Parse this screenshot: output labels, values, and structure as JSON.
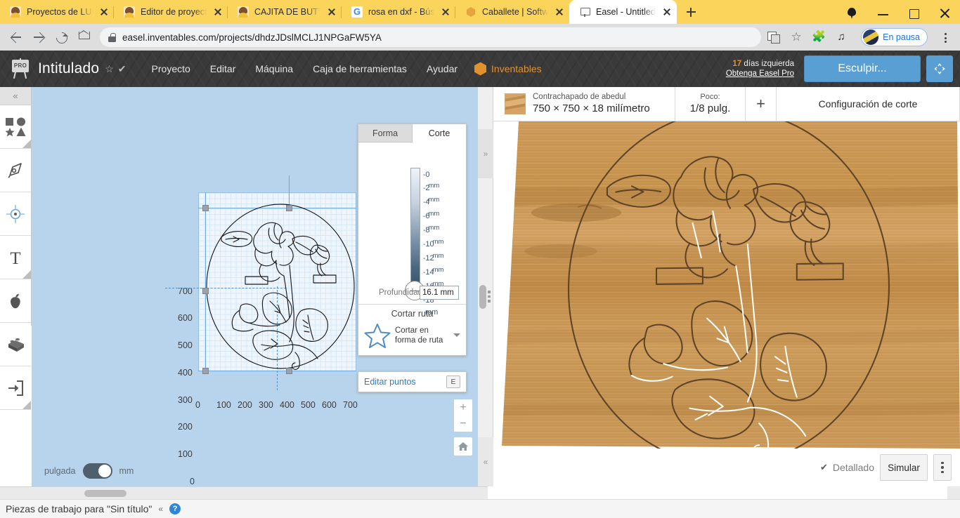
{
  "browser": {
    "tabs": [
      {
        "title": "Proyectos de LUCERO",
        "favicon": "lucero-avatar-icon",
        "active": false
      },
      {
        "title": "Editor de proyectos - I",
        "favicon": "lucero-avatar-icon",
        "active": false
      },
      {
        "title": "CAJITA DE BUTTERFLY",
        "favicon": "lucero-avatar-icon",
        "active": false
      },
      {
        "title": "rosa en dxf - Búsqueda",
        "favicon": "google-icon",
        "active": false
      },
      {
        "title": "Caballete | Software CN",
        "favicon": "inventables-hex-icon",
        "active": false
      },
      {
        "title": "Easel - Untitled",
        "favicon": "easel-icon",
        "active": true
      }
    ],
    "new_tab_label": "+",
    "window_controls": {
      "pin": "location-pin-icon",
      "minimize": "minimize-icon",
      "maximize": "maximize-icon",
      "close": "close-icon"
    },
    "toolbar": {
      "back": "back-arrow-icon",
      "forward": "forward-arrow-icon",
      "reload": "reload-icon",
      "home": "home-icon",
      "lock": "lock-icon",
      "url": "easel.inventables.com/projects/dhdzJDslMCLJ1NPGaFW5YA",
      "translate": "translate-icon",
      "bookmark": "star-icon",
      "extensions": "puzzle-icon",
      "media": "media-list-icon",
      "profile_label": "En pausa",
      "menu": "kebab-menu-icon"
    }
  },
  "easel_header": {
    "logo": "easel-pro-logo",
    "project_title": "Intitulado",
    "star": "☆",
    "check": "✔",
    "menus": [
      "Proyecto",
      "Editar",
      "Máquina",
      "Caja de herramientas",
      "Ayudar"
    ],
    "inventables_label": "Inventables",
    "trial_days_number": "17",
    "trial_days_text": " días izquierda",
    "trial_link": "Obtenga Easel Pro",
    "carve_button": "Esculpir...",
    "fullscreen_icon": "expand-arrows-icon"
  },
  "tool_rail": {
    "collapse_icon": "«",
    "items": [
      {
        "name": "shapes-tool",
        "icon": "shapes-icon"
      },
      {
        "name": "pen-tool",
        "icon": "pen-nib-icon"
      },
      {
        "name": "center-point-tool",
        "icon": "crosshair-icon"
      },
      {
        "name": "text-tool",
        "icon": "text-T-icon"
      },
      {
        "name": "apps-tool",
        "icon": "apple-icon"
      },
      {
        "name": "components-tool",
        "icon": "brick-icon"
      },
      {
        "name": "import-tool",
        "icon": "import-arrow-icon"
      }
    ]
  },
  "canvas": {
    "y_axis_ticks": [
      "700",
      "600",
      "500",
      "400",
      "300",
      "200",
      "100",
      "0"
    ],
    "x_axis_ticks": [
      "0",
      "100",
      "200",
      "300",
      "400",
      "500",
      "600",
      "700"
    ],
    "unit_left_label": "pulgada",
    "unit_right_label": "mm",
    "unit_selected": "mm",
    "zoom_in": "+",
    "zoom_out": "−",
    "zoom_home": "home-icon"
  },
  "cut_panel": {
    "tabs": [
      {
        "label": "Forma",
        "active": false
      },
      {
        "label": "Corte",
        "active": true
      }
    ],
    "slider_ticks": [
      {
        "num": "0",
        "unit": ""
      },
      {
        "num": "2",
        "unit": "mm"
      },
      {
        "num": "4",
        "unit": "mm"
      },
      {
        "num": "6",
        "unit": "mm"
      },
      {
        "num": "8",
        "unit": "mm"
      },
      {
        "num": "10",
        "unit": "mm"
      },
      {
        "num": "12",
        "unit": "mm"
      },
      {
        "num": "14",
        "unit": "mm"
      },
      {
        "num": "16",
        "unit": "mm"
      },
      {
        "num": "18",
        "unit": "mm"
      }
    ],
    "slider_unit_footer": "mm",
    "depth_label": "Profundidad",
    "depth_value": "16.1 mm",
    "cut_path_title": "Cortar ruta",
    "cut_path_icon": "star-outline-icon",
    "cut_path_value": "Cortar en forma de ruta",
    "edit_points_label": "Editar puntos",
    "edit_points_shortcut": "E"
  },
  "divider": {
    "expand_icon": "»",
    "collapse_icon": "«",
    "handle": "drag-handle",
    "dots": "grip-dots-icon"
  },
  "preview": {
    "material_swatch": "wood-swatch",
    "material_name": "Contrachapado de abedul",
    "material_dims": "750 × 750 × 18 milímetro",
    "bit_label": "Poco:",
    "bit_value": "1/8 pulg.",
    "add_label": "+",
    "cut_settings_label": "Configuración de corte",
    "detailed_label": "Detallado",
    "detailed_check": "✔",
    "simulate_label": "Simular",
    "kebab": "kebab-menu-icon"
  },
  "status_bar": {
    "text": "Piezas de trabajo para \"Sin título\"",
    "caret": "«",
    "help": "?"
  },
  "colors": {
    "tabstrip_yellow": "#fbd45c",
    "easel_header_dark": "#3a3a3a",
    "accent_blue": "#5a9fd4",
    "link_blue": "#2f7bc4",
    "inventables_orange": "#e2922c",
    "canvas_blue": "#b8d4ec",
    "wood_brown": "#c08f50"
  }
}
